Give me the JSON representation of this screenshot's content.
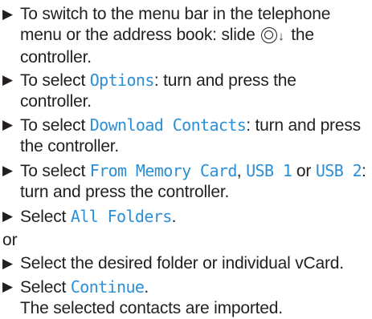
{
  "steps": [
    {
      "marker": "▶",
      "text_before": "To switch to the menu bar in the telephone menu or the address book: slide ",
      "icon": "controller-icon",
      "arrow": "↓",
      "text_after": " the controller."
    },
    {
      "marker": "▶",
      "text_before": "To select ",
      "keyword": "Options",
      "text_after": ": turn and press the controller."
    },
    {
      "marker": "▶",
      "text_before": "To select ",
      "keyword": "Download Contacts",
      "text_after": ": turn and press the controller."
    },
    {
      "marker": "▶",
      "text_before": "To select ",
      "keyword": "From Memory Card",
      "sep1": ", ",
      "keyword2": "USB 1",
      "sep2": " or ",
      "keyword3": "USB 2",
      "text_after": ": turn and press the controller."
    },
    {
      "marker": "▶",
      "text_before": "Select ",
      "keyword": "All Folders",
      "text_after": "."
    },
    {
      "marker": "▶",
      "text_before": "Select the desired folder or individual vCard."
    },
    {
      "marker": "▶",
      "text_before": "Select ",
      "keyword": "Continue",
      "text_after": ".",
      "result": "The selected contacts are imported."
    }
  ],
  "or_label": "or",
  "colors": {
    "text": "#231f20",
    "keyword": "#2a8fd6"
  }
}
